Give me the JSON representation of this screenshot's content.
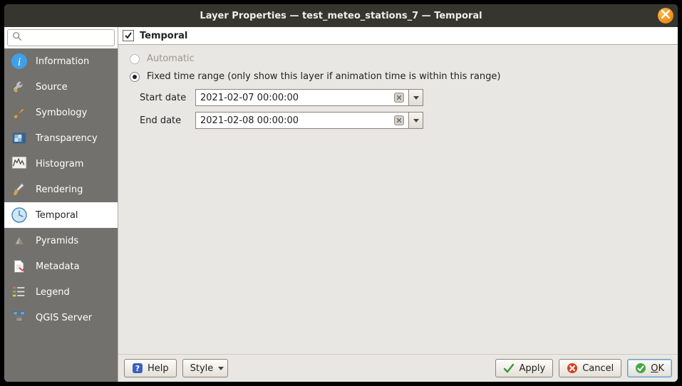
{
  "title": "Layer Properties — test_meteo_stations_7 — Temporal",
  "search_placeholder": "",
  "sidebar": {
    "items": [
      {
        "label": "Information"
      },
      {
        "label": "Source"
      },
      {
        "label": "Symbology"
      },
      {
        "label": "Transparency"
      },
      {
        "label": "Histogram"
      },
      {
        "label": "Rendering"
      },
      {
        "label": "Temporal"
      },
      {
        "label": "Pyramids"
      },
      {
        "label": "Metadata"
      },
      {
        "label": "Legend"
      },
      {
        "label": "QGIS Server"
      }
    ],
    "selected_index": 6
  },
  "main": {
    "header_checkbox_label": "Temporal",
    "header_checked": true,
    "options": {
      "automatic_label": "Automatic",
      "fixed_label": "Fixed time range (only show this layer if animation time is within this range)",
      "selected": "fixed"
    },
    "dates": {
      "start_label": "Start date",
      "start_value": "2021-02-07 00:00:00",
      "end_label": "End date",
      "end_value": "2021-02-08 00:00:00"
    }
  },
  "buttons": {
    "help": "Help",
    "style": "Style",
    "apply": "Apply",
    "cancel": "Cancel",
    "ok_prefix": "O",
    "ok_suffix": "K"
  }
}
